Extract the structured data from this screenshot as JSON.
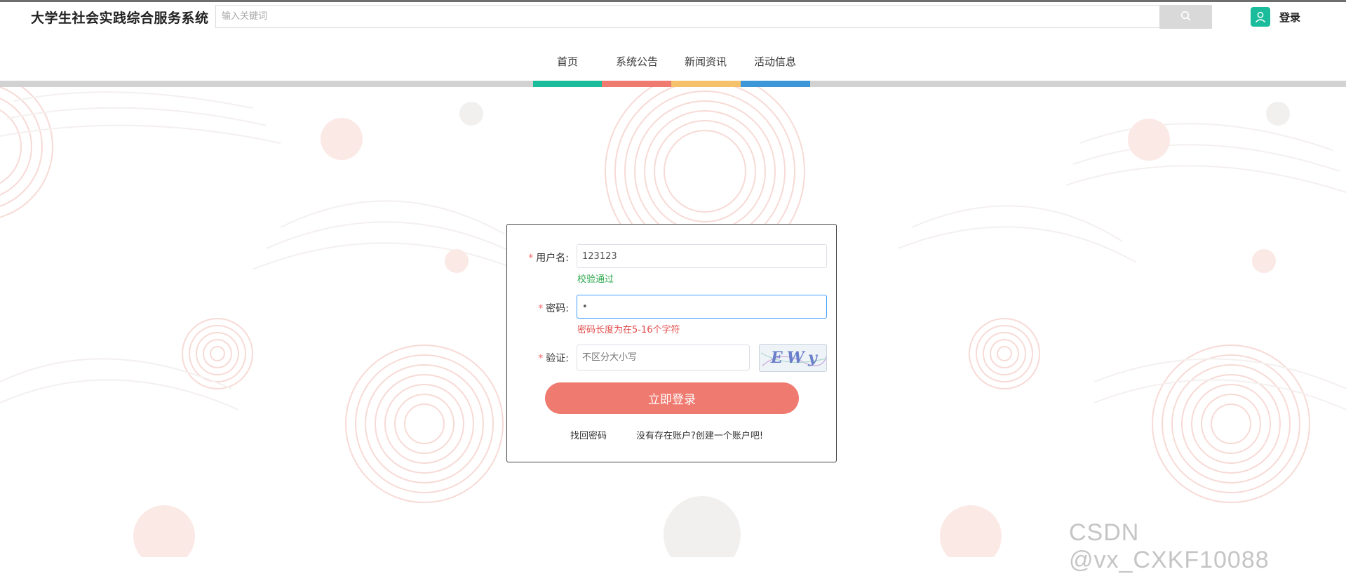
{
  "header": {
    "site_title": "大学生社会实践综合服务系统",
    "search_placeholder": "输入关键词",
    "login_label": "登录"
  },
  "nav": {
    "items": [
      {
        "label": "首页",
        "color": "#1bbc9b"
      },
      {
        "label": "系统公告",
        "color": "#ef7a70"
      },
      {
        "label": "新闻资讯",
        "color": "#f5c26b"
      },
      {
        "label": "活动信息",
        "color": "#3c96d8"
      }
    ]
  },
  "login_form": {
    "username_label": "用户名:",
    "username_value": "123123",
    "username_message": "校验通过",
    "password_label": "密码:",
    "password_value": "•",
    "password_message": "密码长度为在5-16个字符",
    "captcha_label": "验证:",
    "captcha_placeholder": "不区分大小写",
    "captcha_text": "EWy",
    "submit_label": "立即登录",
    "forgot_link": "找回密码",
    "register_link": "没有存在账户?创建一个账户吧!"
  },
  "watermark": "CSDN @vx_CXKF10088",
  "colors": {
    "accent": "#ef7a70",
    "success": "#2fa84f",
    "error": "#e34b4b",
    "teal": "#1bbc9b",
    "focus": "#409eff"
  },
  "icons": {
    "search": "search-icon",
    "user": "user-icon"
  }
}
